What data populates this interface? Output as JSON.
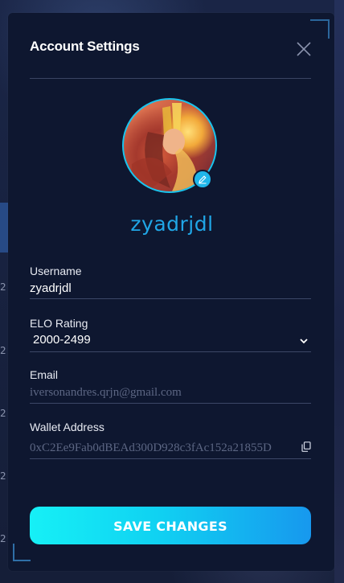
{
  "background": {
    "row_numbers": [
      "2",
      "2",
      "2",
      "2",
      "2",
      "2"
    ]
  },
  "modal": {
    "title": "Account Settings",
    "close_icon": "close-icon"
  },
  "profile": {
    "display_name": "zyadrjdl",
    "avatar_icon": "avatar-image",
    "edit_icon": "pencil-icon"
  },
  "fields": {
    "username": {
      "label": "Username",
      "value": "zyadrjdl"
    },
    "elo": {
      "label": "ELO Rating",
      "selected": "2000-2499",
      "icon": "chevron-down-icon"
    },
    "email": {
      "label": "Email",
      "value": "iversonandres.qrjn@gmail.com"
    },
    "wallet": {
      "label": "Wallet Address",
      "value": "0xC2Ee9Fab0dBEAd300D928c3fAc152a21855D",
      "icon": "copy-icon"
    }
  },
  "actions": {
    "save_label": "SAVE CHANGES"
  },
  "colors": {
    "accent": "#19c4ee",
    "name_color": "#20a6e6",
    "modal_bg": "#0e1730",
    "button_start": "#16f0f6",
    "button_end": "#1798ee"
  }
}
